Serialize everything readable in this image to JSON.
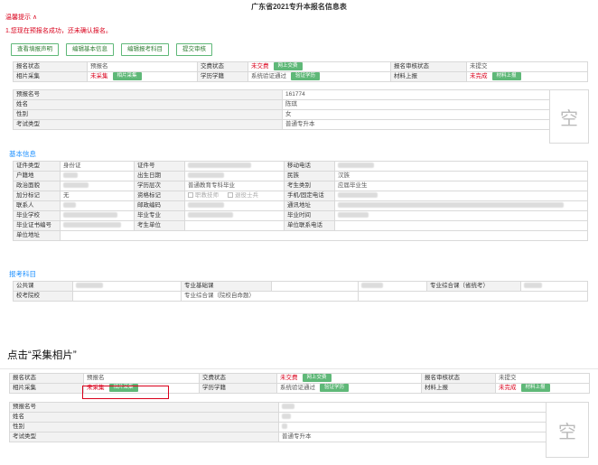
{
  "page_title": "广东省2021专升本报名信息表",
  "notice": {
    "title": "温馨提示 ∧",
    "message": "1.您现在预报名成功，还未确认报名。"
  },
  "toolbar": [
    {
      "label": "查看填报声明"
    },
    {
      "label": "编辑基本信息"
    },
    {
      "label": "编辑报考科目"
    },
    {
      "label": "提交审核"
    }
  ],
  "status": {
    "reg_status_label": "报名状态",
    "reg_status_value": "预报名",
    "pay_status_label": "交费状态",
    "pay_status_value": "未交费",
    "pay_button": "网上交费",
    "audit_status_label": "报名审核状态",
    "audit_status_value": "未提交",
    "photo_label": "相片采集",
    "photo_value": "未采集",
    "photo_button": "相片采集",
    "edu_label": "学历学籍",
    "edu_value": "系统验证通过",
    "edu_button": "验证学历",
    "material_label": "材料上报",
    "material_value": "未完成",
    "material_button": "材料上报"
  },
  "summary": {
    "prereg_no_label": "预报名号",
    "prereg_no_value": "161774",
    "name_label": "姓名",
    "name_value": "陈琪",
    "gender_label": "性别",
    "gender_value": "女",
    "exam_type_label": "考试类型",
    "exam_type_value": "普通专升本",
    "photo_placeholder": "空"
  },
  "basic": {
    "section_title": "基本信息",
    "id_type_label": "证件类型",
    "id_type_value": "身份证",
    "id_no_label": "证件号",
    "mobile_label": "移动电话",
    "hukou_label": "户籍地",
    "birth_label": "出生日期",
    "ethnic_label": "民族",
    "ethnic_value": "汉族",
    "political_label": "政治面貌",
    "edu_level_label": "学历层次",
    "edu_level_value": "普通教育专科毕业",
    "candidate_type_label": "考生类别",
    "candidate_type_value": "应届毕业生",
    "bonus_label": "加分标记",
    "bonus_value": "无",
    "quals_label": "资格标记",
    "qual_opt1": "职教技师",
    "qual_opt2": "退役士兵",
    "phone_label": "手机/固定电话",
    "contact_label": "联系人",
    "postcode_label": "邮政编码",
    "address_label": "通讯地址",
    "school_label": "毕业学校",
    "major_label": "毕业专业",
    "grad_time_label": "毕业时间",
    "cert_no_label": "毕业证书编号",
    "unit_label": "考生单位",
    "unit_phone_label": "单位联系电话",
    "unit_addr_label": "单位地址"
  },
  "subjects": {
    "section_title": "报考科目",
    "public_label": "公共课",
    "basic_label": "专业基础课",
    "comp_label": "专业综合课（省统考）",
    "school_exam_label": "校考院校",
    "comp_school_label": "专业综合课（院校自命题）"
  },
  "caption": "点击“采集相片”"
}
